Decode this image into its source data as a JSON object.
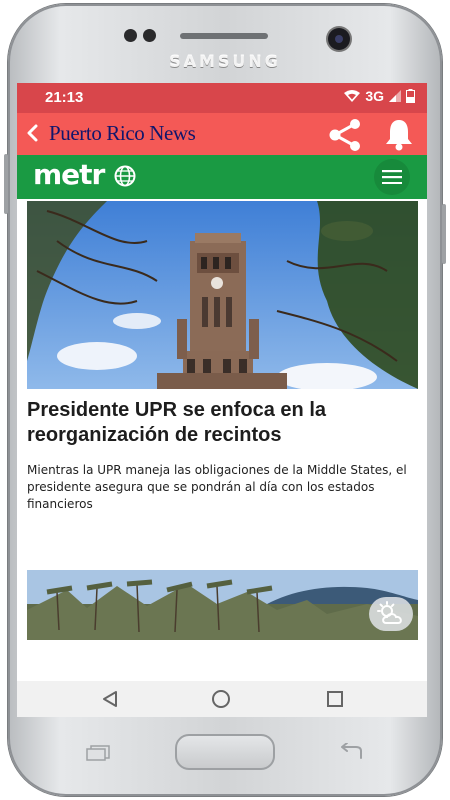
{
  "device": {
    "brand": "SAMSUNG"
  },
  "status_bar": {
    "time": "21:13",
    "network": "3G",
    "bar_color": "#d8464b"
  },
  "app_bar": {
    "title": "Puerto Rico News",
    "color": "#f45956",
    "icons": [
      "back-icon",
      "share-icon",
      "bell-icon"
    ]
  },
  "site_header": {
    "logo": "metr",
    "color": "#1a9a43",
    "icons": [
      "globe-icon",
      "menu-icon"
    ]
  },
  "article": {
    "headline": "Presidente UPR se enfoca en la reorganización de recintos",
    "summary": "Mientras la UPR maneja las obligaciones de la Middle States, el presidente asegura que se pondrán al día con los estados financieros"
  },
  "nav_bar": {
    "icons": [
      "nav-back-icon",
      "nav-home-icon",
      "nav-recent-icon"
    ]
  }
}
